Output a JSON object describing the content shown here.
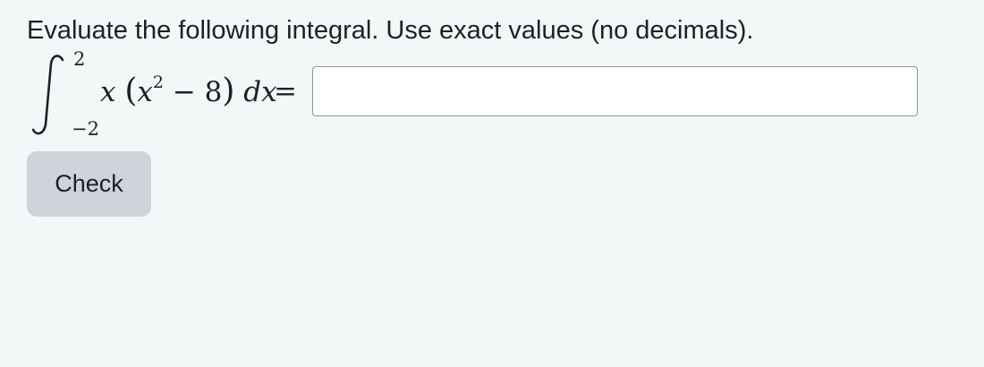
{
  "question": {
    "prompt": "Evaluate the following integral. Use exact values (no decimals)."
  },
  "integral": {
    "upper_limit": "2",
    "lower_limit": "−2",
    "integrand_x": "x",
    "open_paren": "(",
    "inner_var": "x",
    "exponent": "2",
    "inner_rest": " − 8",
    "close_paren": ")",
    "differential": "dx",
    "equals": "="
  },
  "answer": {
    "value": "",
    "placeholder": ""
  },
  "buttons": {
    "check_label": "Check"
  },
  "colors": {
    "background": "#f2f7f7",
    "text": "#1d2125",
    "input_border": "#8f959e",
    "button_bg": "#ced4da"
  },
  "icons": {
    "integral": "integral-sign-icon"
  }
}
